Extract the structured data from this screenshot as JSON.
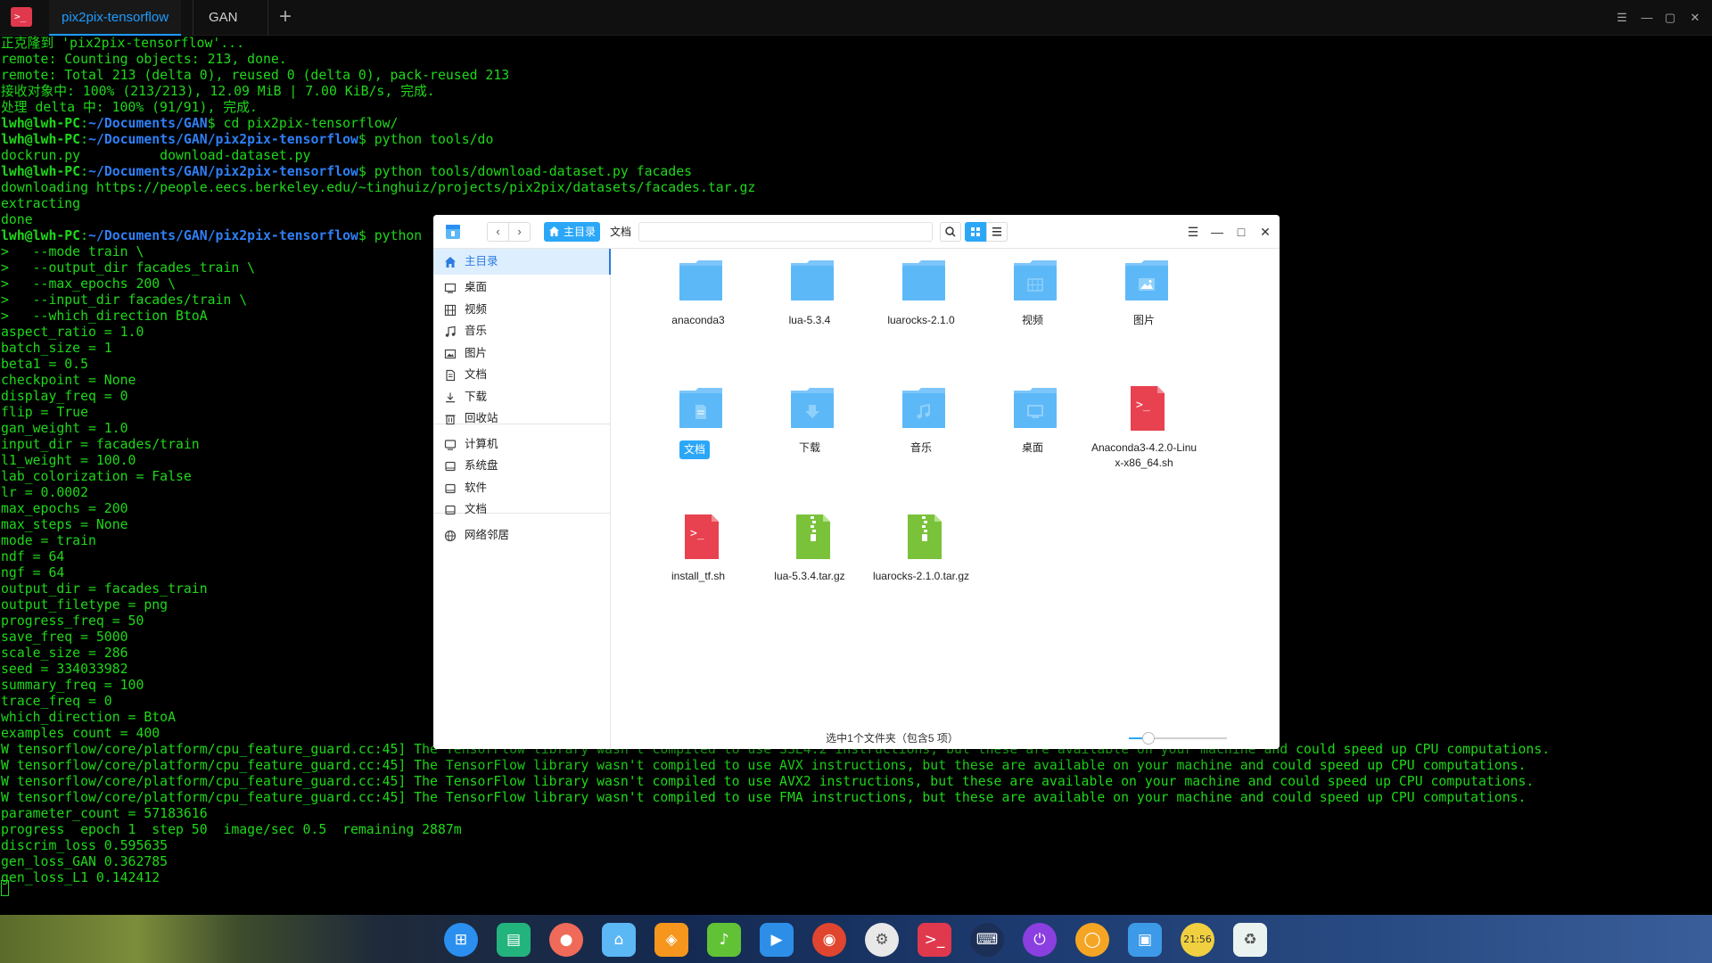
{
  "terminal": {
    "tabs": [
      {
        "label": "pix2pix-tensorflow",
        "active": true
      },
      {
        "label": "GAN",
        "active": false
      }
    ],
    "new_tab_glyph": "+",
    "window_controls": [
      "☰",
      "—",
      "▢",
      "✕"
    ],
    "lines": [
      {
        "segments": [
          {
            "t": "正克隆到 'pix2pix-tensorflow'...",
            "c": "out"
          }
        ]
      },
      {
        "segments": [
          {
            "t": "remote: Counting objects: 213, done.",
            "c": "out"
          }
        ]
      },
      {
        "segments": [
          {
            "t": "remote: Total 213 (delta 0), reused 0 (delta 0), pack-reused 213",
            "c": "out"
          }
        ]
      },
      {
        "segments": [
          {
            "t": "接收对象中: 100% (213/213), 12.09 MiB | 7.00 KiB/s, 完成.",
            "c": "out"
          }
        ]
      },
      {
        "segments": [
          {
            "t": "处理 delta 中: 100% (91/91), 完成.",
            "c": "out"
          }
        ]
      },
      {
        "segments": [
          {
            "t": "lwh@lwh-PC",
            "c": "user"
          },
          {
            "t": ":",
            "c": "out"
          },
          {
            "t": "~/Documents/GAN",
            "c": "path"
          },
          {
            "t": "$ cd pix2pix-tensorflow/",
            "c": "out"
          }
        ]
      },
      {
        "segments": [
          {
            "t": "lwh@lwh-PC",
            "c": "user"
          },
          {
            "t": ":",
            "c": "out"
          },
          {
            "t": "~/Documents/GAN/pix2pix-tensorflow",
            "c": "path"
          },
          {
            "t": "$ python tools/do",
            "c": "out"
          }
        ]
      },
      {
        "segments": [
          {
            "t": "dockrun.py          download-dataset.py",
            "c": "out"
          }
        ]
      },
      {
        "segments": [
          {
            "t": "lwh@lwh-PC",
            "c": "user"
          },
          {
            "t": ":",
            "c": "out"
          },
          {
            "t": "~/Documents/GAN/pix2pix-tensorflow",
            "c": "path"
          },
          {
            "t": "$ python tools/download-dataset.py facades",
            "c": "out"
          }
        ]
      },
      {
        "segments": [
          {
            "t": "downloading https://people.eecs.berkeley.edu/~tinghuiz/projects/pix2pix/datasets/facades.tar.gz",
            "c": "out"
          }
        ]
      },
      {
        "segments": [
          {
            "t": "extracting",
            "c": "out"
          }
        ]
      },
      {
        "segments": [
          {
            "t": "done",
            "c": "out"
          }
        ]
      },
      {
        "segments": [
          {
            "t": "lwh@lwh-PC",
            "c": "user"
          },
          {
            "t": ":",
            "c": "out"
          },
          {
            "t": "~/Documents/GAN/pix2pix-tensorflow",
            "c": "path"
          },
          {
            "t": "$ python",
            "c": "out"
          }
        ]
      },
      {
        "segments": [
          {
            "t": ">   --mode train \\",
            "c": "out"
          }
        ]
      },
      {
        "segments": [
          {
            "t": ">   --output_dir facades_train \\",
            "c": "out"
          }
        ]
      },
      {
        "segments": [
          {
            "t": ">   --max_epochs 200 \\",
            "c": "out"
          }
        ]
      },
      {
        "segments": [
          {
            "t": ">   --input_dir facades/train \\",
            "c": "out"
          }
        ]
      },
      {
        "segments": [
          {
            "t": ">   --which_direction BtoA",
            "c": "out"
          }
        ]
      },
      {
        "segments": [
          {
            "t": "aspect_ratio = 1.0",
            "c": "out"
          }
        ]
      },
      {
        "segments": [
          {
            "t": "batch_size = 1",
            "c": "out"
          }
        ]
      },
      {
        "segments": [
          {
            "t": "beta1 = 0.5",
            "c": "out"
          }
        ]
      },
      {
        "segments": [
          {
            "t": "checkpoint = None",
            "c": "out"
          }
        ]
      },
      {
        "segments": [
          {
            "t": "display_freq = 0",
            "c": "out"
          }
        ]
      },
      {
        "segments": [
          {
            "t": "flip = True",
            "c": "out"
          }
        ]
      },
      {
        "segments": [
          {
            "t": "gan_weight = 1.0",
            "c": "out"
          }
        ]
      },
      {
        "segments": [
          {
            "t": "input_dir = facades/train",
            "c": "out"
          }
        ]
      },
      {
        "segments": [
          {
            "t": "l1_weight = 100.0",
            "c": "out"
          }
        ]
      },
      {
        "segments": [
          {
            "t": "lab_colorization = False",
            "c": "out"
          }
        ]
      },
      {
        "segments": [
          {
            "t": "lr = 0.0002",
            "c": "out"
          }
        ]
      },
      {
        "segments": [
          {
            "t": "max_epochs = 200",
            "c": "out"
          }
        ]
      },
      {
        "segments": [
          {
            "t": "max_steps = None",
            "c": "out"
          }
        ]
      },
      {
        "segments": [
          {
            "t": "mode = train",
            "c": "out"
          }
        ]
      },
      {
        "segments": [
          {
            "t": "ndf = 64",
            "c": "out"
          }
        ]
      },
      {
        "segments": [
          {
            "t": "ngf = 64",
            "c": "out"
          }
        ]
      },
      {
        "segments": [
          {
            "t": "output_dir = facades_train",
            "c": "out"
          }
        ]
      },
      {
        "segments": [
          {
            "t": "output_filetype = png",
            "c": "out"
          }
        ]
      },
      {
        "segments": [
          {
            "t": "progress_freq = 50",
            "c": "out"
          }
        ]
      },
      {
        "segments": [
          {
            "t": "save_freq = 5000",
            "c": "out"
          }
        ]
      },
      {
        "segments": [
          {
            "t": "scale_size = 286",
            "c": "out"
          }
        ]
      },
      {
        "segments": [
          {
            "t": "seed = 334033982",
            "c": "out"
          }
        ]
      },
      {
        "segments": [
          {
            "t": "summary_freq = 100",
            "c": "out"
          }
        ]
      },
      {
        "segments": [
          {
            "t": "trace_freq = 0",
            "c": "out"
          }
        ]
      },
      {
        "segments": [
          {
            "t": "which_direction = BtoA",
            "c": "out"
          }
        ]
      },
      {
        "segments": [
          {
            "t": "examples count = 400",
            "c": "out"
          }
        ]
      },
      {
        "segments": [
          {
            "t": "W tensorflow/core/platform/cpu_feature_guard.cc:45] The TensorFlow library wasn't compiled to use SSE4.2 instructions, but these are available on your machine and could speed up CPU computations.",
            "c": "out"
          }
        ]
      },
      {
        "segments": [
          {
            "t": "W tensorflow/core/platform/cpu_feature_guard.cc:45] The TensorFlow library wasn't compiled to use AVX instructions, but these are available on your machine and could speed up CPU computations.",
            "c": "out"
          }
        ]
      },
      {
        "segments": [
          {
            "t": "W tensorflow/core/platform/cpu_feature_guard.cc:45] The TensorFlow library wasn't compiled to use AVX2 instructions, but these are available on your machine and could speed up CPU computations.",
            "c": "out"
          }
        ]
      },
      {
        "segments": [
          {
            "t": "W tensorflow/core/platform/cpu_feature_guard.cc:45] The TensorFlow library wasn't compiled to use FMA instructions, but these are available on your machine and could speed up CPU computations.",
            "c": "out"
          }
        ]
      },
      {
        "segments": [
          {
            "t": "parameter_count = 57183616",
            "c": "out"
          }
        ]
      },
      {
        "segments": [
          {
            "t": "progress  epoch 1  step 50  image/sec 0.5  remaining 2887m",
            "c": "out"
          }
        ]
      },
      {
        "segments": [
          {
            "t": "discrim_loss 0.595635",
            "c": "out"
          }
        ]
      },
      {
        "segments": [
          {
            "t": "gen_loss_GAN 0.362785",
            "c": "out"
          }
        ]
      },
      {
        "segments": [
          {
            "t": "gen_loss_L1 0.142412",
            "c": "out"
          }
        ]
      }
    ]
  },
  "file_manager": {
    "breadcrumb": {
      "home": "主目录",
      "current": "文档"
    },
    "sidebar": [
      {
        "label": "主目录",
        "icon": "home-icon",
        "active": true
      },
      {
        "label": "桌面",
        "icon": "desktop-icon"
      },
      {
        "label": "视频",
        "icon": "video-icon"
      },
      {
        "label": "音乐",
        "icon": "music-icon"
      },
      {
        "label": "图片",
        "icon": "picture-icon"
      },
      {
        "label": "文档",
        "icon": "document-icon"
      },
      {
        "label": "下载",
        "icon": "download-icon"
      },
      {
        "label": "回收站",
        "icon": "trash-icon"
      },
      {
        "label": "计算机",
        "icon": "computer-icon"
      },
      {
        "label": "系统盘",
        "icon": "disk-icon"
      },
      {
        "label": "软件",
        "icon": "disk-icon"
      },
      {
        "label": "文档",
        "icon": "disk-icon"
      },
      {
        "label": "网络邻居",
        "icon": "network-icon"
      }
    ],
    "files": [
      {
        "name": "anaconda3",
        "kind": "folder",
        "emblem": ""
      },
      {
        "name": "lua-5.3.4",
        "kind": "folder",
        "emblem": ""
      },
      {
        "name": "luarocks-2.1.0",
        "kind": "folder",
        "emblem": ""
      },
      {
        "name": "视频",
        "kind": "folder",
        "emblem": "video"
      },
      {
        "name": "图片",
        "kind": "folder",
        "emblem": "picture"
      },
      {
        "name": "文档",
        "kind": "folder",
        "emblem": "document",
        "selected": true
      },
      {
        "name": "下载",
        "kind": "folder",
        "emblem": "download"
      },
      {
        "name": "音乐",
        "kind": "folder",
        "emblem": "music"
      },
      {
        "name": "桌面",
        "kind": "folder",
        "emblem": "desktop"
      },
      {
        "name": "Anaconda3-4.2.0-Linux-x86_64.sh",
        "kind": "script",
        "emblem": ""
      },
      {
        "name": "install_tf.sh",
        "kind": "script",
        "emblem": ""
      },
      {
        "name": "lua-5.3.4.tar.gz",
        "kind": "archive",
        "emblem": ""
      },
      {
        "name": "luarocks-2.1.0.tar.gz",
        "kind": "archive",
        "emblem": ""
      }
    ],
    "status": "选中1个文件夹（包含5 项）",
    "zoom_level": 0.2
  },
  "dock": {
    "items": [
      {
        "name": "launcher-icon",
        "color": "#2b8ff0",
        "glyph": "⊞",
        "round": true
      },
      {
        "name": "multitask-view-icon",
        "color": "#23b47e",
        "glyph": "▤"
      },
      {
        "name": "screen-recorder-icon",
        "color": "#f06a5a",
        "glyph": "●",
        "round": true
      },
      {
        "name": "file-manager-icon",
        "color": "#5cb7f5",
        "glyph": "⌂"
      },
      {
        "name": "app-store-icon",
        "color": "#f7961d",
        "glyph": "◈"
      },
      {
        "name": "music-player-icon",
        "color": "#62c236",
        "glyph": "♪"
      },
      {
        "name": "video-player-icon",
        "color": "#2d8ee8",
        "glyph": "▶"
      },
      {
        "name": "chrome-browser-icon",
        "color": "#e0452f",
        "glyph": "◉",
        "round": true
      },
      {
        "name": "system-settings-icon",
        "color": "#e8e8e8",
        "glyph": "⚙",
        "round": true
      },
      {
        "name": "terminal-icon",
        "color": "#e0384d",
        "glyph": ">_"
      },
      {
        "name": "theme-switcher-icon",
        "color": "#1c2f57",
        "glyph": "⌨",
        "round": true
      },
      {
        "name": "power-icon",
        "color": "#8b3fe0",
        "glyph": "⏻",
        "round": true
      },
      {
        "name": "browser-icon",
        "color": "#f5a524",
        "glyph": "◯",
        "round": true
      },
      {
        "name": "image-viewer-icon",
        "color": "#3c9ae8",
        "glyph": "▣"
      },
      {
        "name": "clock-icon",
        "color": "#f0d040",
        "glyph": "21:56",
        "round": true
      },
      {
        "name": "recycle-bin-icon",
        "color": "#eaf3f0",
        "glyph": "♻"
      }
    ]
  }
}
